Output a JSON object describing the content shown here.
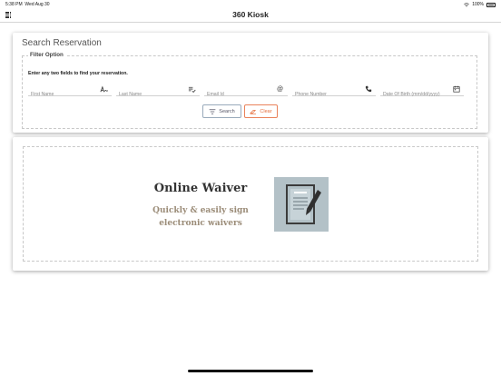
{
  "status_bar": {
    "time": "5:38 PM",
    "date": "Wed Aug 30",
    "battery": "100%"
  },
  "app": {
    "title": "360 Kiosk",
    "menu_icon": "grid-icon"
  },
  "search": {
    "title": "Search Reservation",
    "filter_legend": "Filter Option",
    "hint": "Enter any two fields to find your reservation.",
    "fields": [
      {
        "placeholder": "First Name",
        "icon": "handwriting-icon"
      },
      {
        "placeholder": "Last Name",
        "icon": "list-check-icon"
      },
      {
        "placeholder": "Email Id",
        "icon": "at-icon"
      },
      {
        "placeholder": "Phone Number",
        "icon": "phone-icon"
      },
      {
        "placeholder": "Date Of Birth (mm/dd/yyyy)",
        "icon": "calendar-icon"
      }
    ],
    "search_button": "Search",
    "clear_button": "Clear",
    "accent_color": "#e66c3a"
  },
  "waiver": {
    "title": "Online Waiver",
    "subtitle_line1": "Quickly & easily sign",
    "subtitle_line2": "electronic waivers",
    "image_icon": "document-pen-icon"
  }
}
